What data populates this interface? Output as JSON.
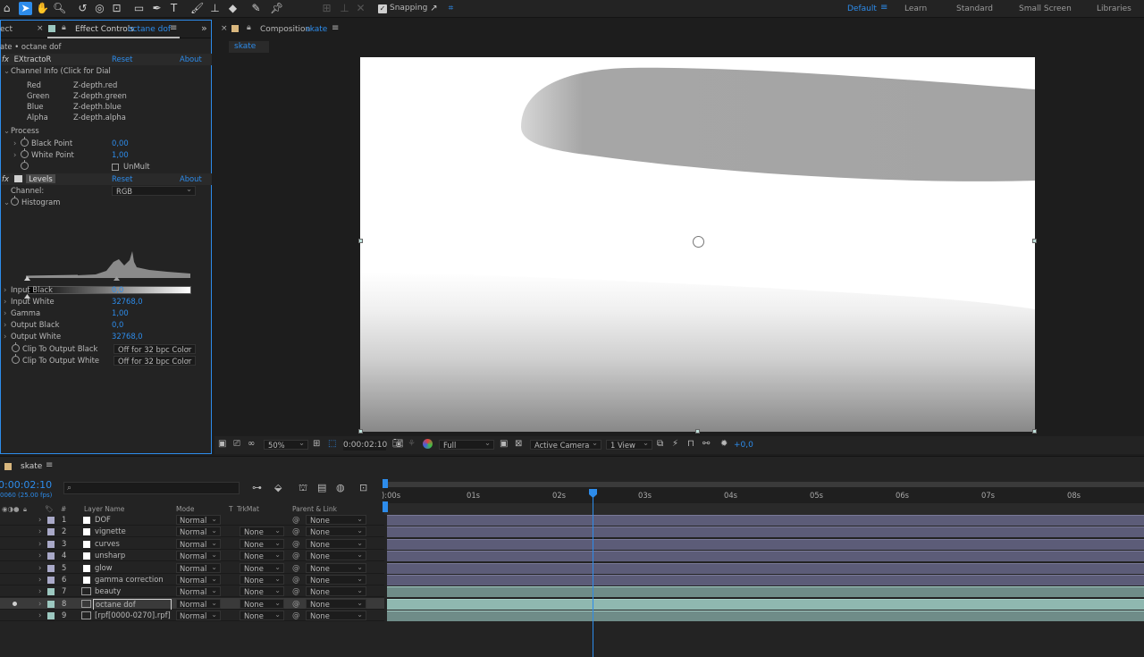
{
  "toolbar": {
    "snapping_label": "Snapping",
    "workspaces": [
      "Default",
      "Learn",
      "Standard",
      "Small Screen",
      "Libraries"
    ]
  },
  "effect_panel": {
    "tab_fx_left": "ect",
    "tab_title": "Effect Controls",
    "tab_layer": "octane dof",
    "breadcrumb": "ate • octane dof",
    "extractor": {
      "name": "EXtractoR",
      "reset": "Reset",
      "about": "About",
      "channel_info": "Channel Info (Click for Dial",
      "channels": [
        {
          "label": "Red",
          "value": "Z-depth.red"
        },
        {
          "label": "Green",
          "value": "Z-depth.green"
        },
        {
          "label": "Blue",
          "value": "Z-depth.blue"
        },
        {
          "label": "Alpha",
          "value": "Z-depth.alpha"
        }
      ],
      "process": "Process",
      "black_point_label": "Black Point",
      "black_point": "0,00",
      "white_point_label": "White Point",
      "white_point": "1,00",
      "unmult": "UnMult"
    },
    "levels": {
      "name": "Levels",
      "reset": "Reset",
      "about": "About",
      "channel_label": "Channel:",
      "channel_value": "RGB",
      "histogram": "Histogram",
      "params": [
        {
          "label": "Input Black",
          "value": "0,0"
        },
        {
          "label": "Input White",
          "value": "32768,0"
        },
        {
          "label": "Gamma",
          "value": "1,00"
        },
        {
          "label": "Output Black",
          "value": "0,0"
        },
        {
          "label": "Output White",
          "value": "32768,0"
        }
      ],
      "clip_black_label": "Clip To Output Black",
      "clip_black_value": "Off for 32 bpc Color",
      "clip_white_label": "Clip To Output White",
      "clip_white_value": "Off for 32 bpc Color"
    }
  },
  "comp_panel": {
    "tab_title": "Composition",
    "tab_name": "skate",
    "sub_tab": "skate",
    "zoom": "50%",
    "timecode": "0:00:02:10",
    "resolution": "Full",
    "camera": "Active Camera",
    "view": "1 View",
    "exposure": "+0,0"
  },
  "timeline": {
    "tab_name": "skate",
    "timecode": "0:00:02:10",
    "frames": "0060 (25.00 fps)",
    "search_placeholder": "",
    "columns": {
      "layer_name": "Layer Name",
      "mode": "Mode",
      "t": "T",
      "trkmat": "TrkMat",
      "parent": "Parent & Link"
    },
    "ticks": [
      "):00s",
      "01s",
      "02s",
      "03s",
      "04s",
      "05s",
      "06s",
      "07s",
      "08s"
    ],
    "layers": [
      {
        "num": "1",
        "name": "DOF",
        "mode": "Normal",
        "trkmat": "",
        "parent": "None",
        "color": "#a9a9c8",
        "type": "solid"
      },
      {
        "num": "2",
        "name": "vignette",
        "mode": "Normal",
        "trkmat": "None",
        "parent": "None",
        "color": "#a9a9c8",
        "type": "solid"
      },
      {
        "num": "3",
        "name": "curves",
        "mode": "Normal",
        "trkmat": "None",
        "parent": "None",
        "color": "#a9a9c8",
        "type": "solid"
      },
      {
        "num": "4",
        "name": "unsharp",
        "mode": "Normal",
        "trkmat": "None",
        "parent": "None",
        "color": "#a9a9c8",
        "type": "solid"
      },
      {
        "num": "5",
        "name": "glow",
        "mode": "Normal",
        "trkmat": "None",
        "parent": "None",
        "color": "#a9a9c8",
        "type": "solid"
      },
      {
        "num": "6",
        "name": "gamma correction",
        "mode": "Normal",
        "trkmat": "None",
        "parent": "None",
        "color": "#a9a9c8",
        "type": "solid"
      },
      {
        "num": "7",
        "name": "beauty",
        "mode": "Normal",
        "trkmat": "None",
        "parent": "None",
        "color": "#9cc8c0",
        "type": "footage"
      },
      {
        "num": "8",
        "name": "octane dof",
        "mode": "Normal",
        "trkmat": "None",
        "parent": "None",
        "color": "#9cc8c0",
        "type": "footage"
      },
      {
        "num": "9",
        "name": "[rpf[0000-0270].rpf]",
        "mode": "Normal",
        "trkmat": "None",
        "parent": "None",
        "color": "#9cc8c0",
        "type": "footage"
      }
    ]
  }
}
